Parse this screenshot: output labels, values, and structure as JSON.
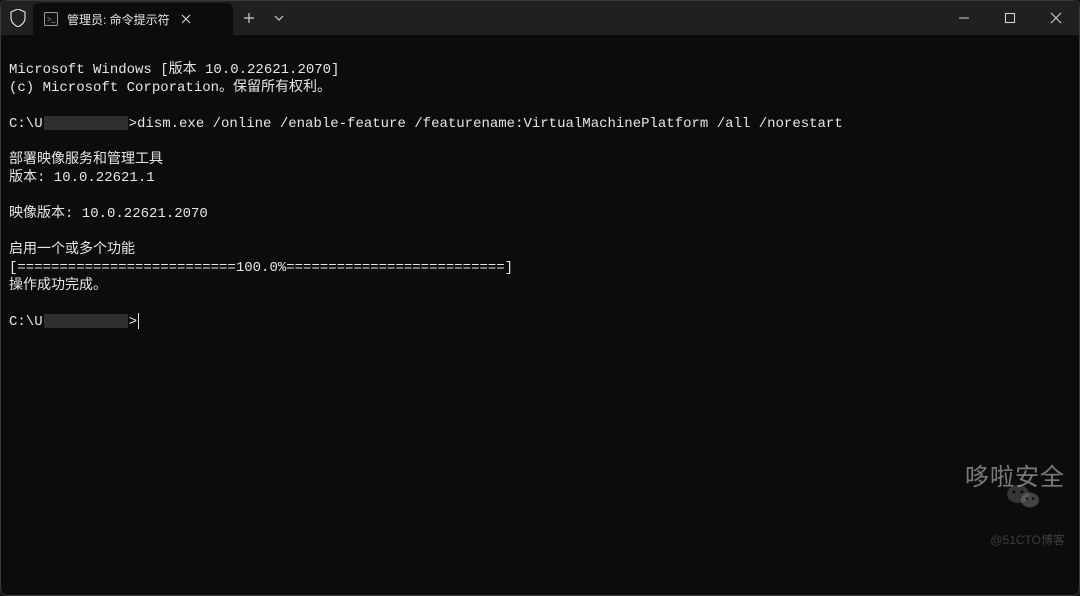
{
  "window": {
    "type": "Windows Terminal",
    "tab_title": "管理员: 命令提示符",
    "shield_icon": "shield",
    "cmd_icon": "cmd-prompt"
  },
  "controls": {
    "new_tab_tooltip": "New tab",
    "dropdown_tooltip": "Tab options",
    "minimize_tooltip": "Minimize",
    "maximize_tooltip": "Maximize",
    "close_tooltip": "Close"
  },
  "terminal": {
    "line1": "Microsoft Windows [版本 10.0.22621.2070]",
    "line2": "(c) Microsoft Corporation。保留所有权利。",
    "blank1": "",
    "prompt1_prefix": "C:\\U",
    "prompt1_gt": ">",
    "command1": "dism.exe /online /enable-feature /featurename:VirtualMachinePlatform /all /norestart",
    "blank2": "",
    "dism_title": "部署映像服务和管理工具",
    "dism_ver": "版本: 10.0.22621.1",
    "blank3": "",
    "image_ver": "映像版本: 10.0.22621.2070",
    "blank4": "",
    "enable_feature": "启用一个或多个功能",
    "progress": "[==========================100.0%==========================]",
    "success": "操作成功完成。",
    "blank5": "",
    "prompt2_prefix": "C:\\U",
    "prompt2_gt": ">"
  },
  "watermark": {
    "text": "哆啦安全",
    "sub": "@51CTO博客"
  }
}
